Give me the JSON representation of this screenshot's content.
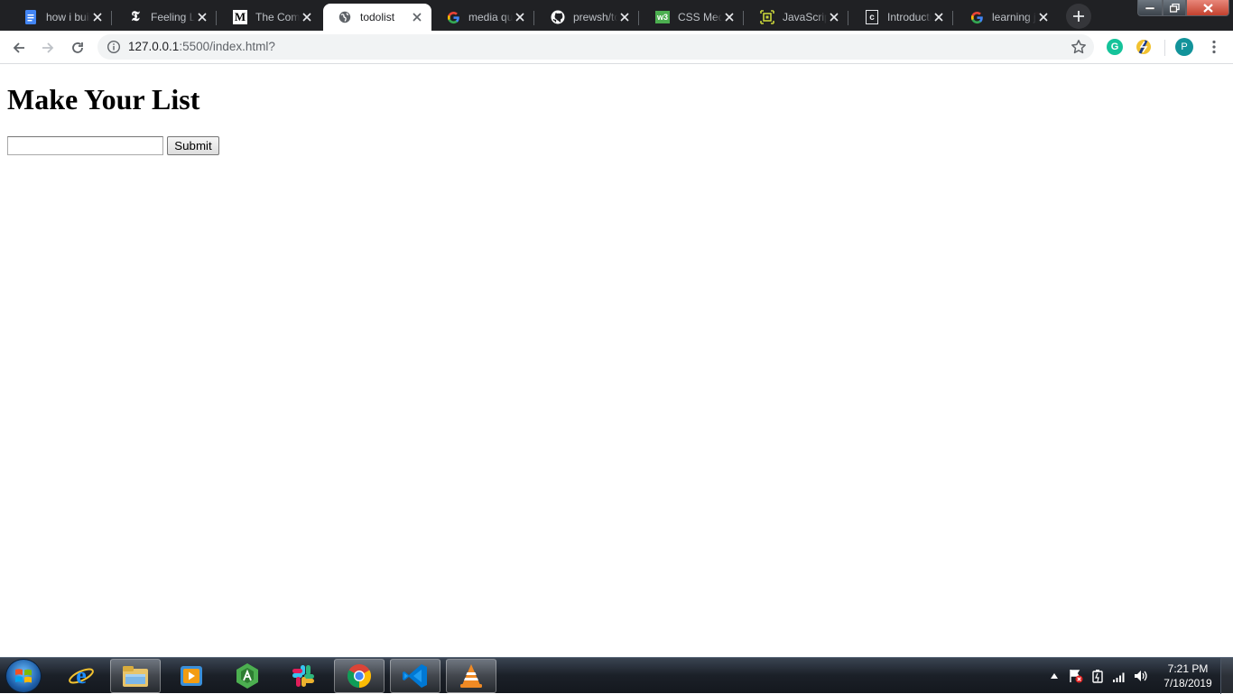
{
  "browser": {
    "tabs": [
      {
        "title": "how i built",
        "icon": "google-docs-icon"
      },
      {
        "title": "Feeling Lonely",
        "icon": "nytimes-icon"
      },
      {
        "title": "The Complete",
        "icon": "medium-icon"
      },
      {
        "title": "todolist",
        "icon": "globe-icon",
        "active": true
      },
      {
        "title": "media queries",
        "icon": "google-icon"
      },
      {
        "title": "prewsh/todo",
        "icon": "github-icon"
      },
      {
        "title": "CSS Media",
        "icon": "w3schools-icon"
      },
      {
        "title": "JavaScript",
        "icon": "scrimba-icon"
      },
      {
        "title": "Introduction",
        "icon": "codecademy-icon"
      },
      {
        "title": "learning js",
        "icon": "google-icon"
      }
    ],
    "url_host": "127.0.0.1",
    "url_rest": ":5500/index.html?",
    "profile_initial": "P",
    "grammarly_letter": "G"
  },
  "page": {
    "heading": "Make Your List",
    "input_value": "",
    "submit_label": "Submit"
  },
  "taskbar": {
    "apps": [
      "internet-explorer-icon",
      "file-explorer-icon",
      "media-player-icon",
      "android-studio-icon",
      "slack-icon",
      "chrome-icon",
      "vscode-icon",
      "vlc-icon"
    ],
    "clock_time": "7:21 PM",
    "clock_date": "7/18/2019"
  },
  "colors": {
    "tabstrip_bg": "#202124",
    "active_tab_bg": "#ffffff",
    "omnibox_bg": "#f1f3f4",
    "profile": "#12939a",
    "grammarly": "#15c39a"
  }
}
